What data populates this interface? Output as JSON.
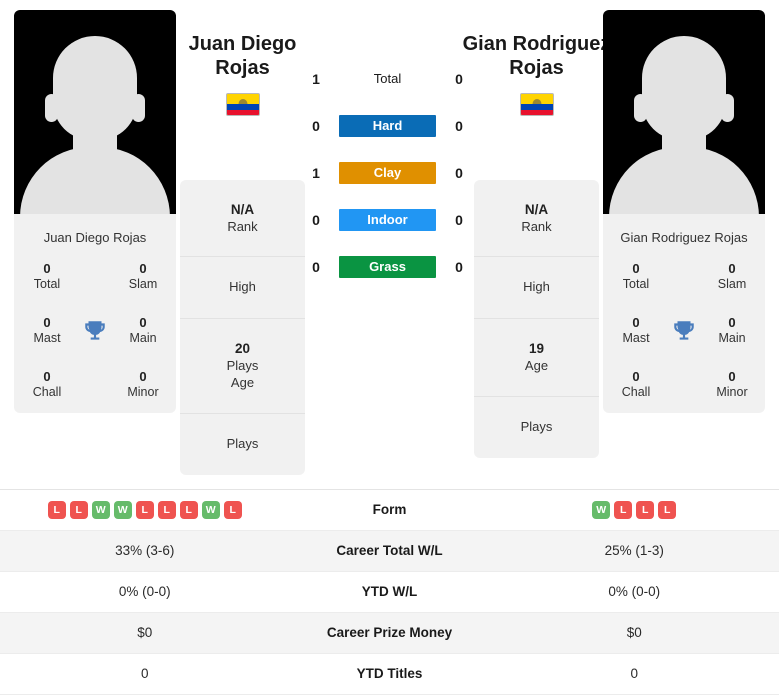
{
  "colors": {
    "hard": "#0a6cb6",
    "clay": "#e09000",
    "indoor": "#2196f3",
    "grass": "#0a9442",
    "win": "#66bb6a",
    "loss": "#ef5350",
    "card_bg": "#f1f1f1",
    "row_shade": "#f4f4f4"
  },
  "left_player": {
    "name_line1": "Juan Diego",
    "name_line2": "Rojas",
    "full_name": "Juan Diego Rojas",
    "country": "Ecuador",
    "avatar": "player-placeholder-silhouette",
    "titles": [
      {
        "value": "0",
        "label": "Total"
      },
      {
        "value": "0",
        "label": "Slam"
      },
      {
        "value": "0",
        "label": "Mast"
      },
      {
        "value": "0",
        "label": "Main"
      },
      {
        "value": "0",
        "label": "Chall"
      },
      {
        "value": "0",
        "label": "Minor"
      }
    ],
    "trophy_icon": "trophy-icon",
    "info": [
      {
        "value": "N/A",
        "label": "Rank"
      },
      {
        "value": "",
        "label": "High"
      },
      {
        "value": "20",
        "label": "Age"
      },
      {
        "value": "",
        "label": "Plays"
      }
    ],
    "form": [
      "L",
      "L",
      "W",
      "W",
      "L",
      "L",
      "L",
      "W",
      "L"
    ]
  },
  "right_player": {
    "name_line1": "Gian Rodriguez",
    "name_line2": "Rojas",
    "full_name": "Gian Rodriguez Rojas",
    "country": "Ecuador",
    "avatar": "player-placeholder-silhouette",
    "titles": [
      {
        "value": "0",
        "label": "Total"
      },
      {
        "value": "0",
        "label": "Slam"
      },
      {
        "value": "0",
        "label": "Mast"
      },
      {
        "value": "0",
        "label": "Main"
      },
      {
        "value": "0",
        "label": "Chall"
      },
      {
        "value": "0",
        "label": "Minor"
      }
    ],
    "trophy_icon": "trophy-icon",
    "info": [
      {
        "value": "N/A",
        "label": "Rank"
      },
      {
        "value": "",
        "label": "High"
      },
      {
        "value": "19",
        "label": "Age"
      },
      {
        "value": "",
        "label": "Plays"
      }
    ],
    "form": [
      "W",
      "L",
      "L",
      "L"
    ]
  },
  "head_to_head": [
    {
      "label": "Total",
      "left": "1",
      "right": "0",
      "style": "plain",
      "color": ""
    },
    {
      "label": "Hard",
      "left": "0",
      "right": "0",
      "style": "badge",
      "color": "#0a6cb6"
    },
    {
      "label": "Clay",
      "left": "1",
      "right": "0",
      "style": "badge",
      "color": "#e09000"
    },
    {
      "label": "Indoor",
      "left": "0",
      "right": "0",
      "style": "badge",
      "color": "#2196f3"
    },
    {
      "label": "Grass",
      "left": "0",
      "right": "0",
      "style": "badge",
      "color": "#0a9442"
    }
  ],
  "stats_rows": [
    {
      "label": "Form",
      "left": "",
      "right": "",
      "type": "form",
      "shaded": false
    },
    {
      "label": "Career Total W/L",
      "left": "33% (3-6)",
      "right": "25% (1-3)",
      "type": "text",
      "shaded": true
    },
    {
      "label": "YTD W/L",
      "left": "0% (0-0)",
      "right": "0% (0-0)",
      "type": "text",
      "shaded": false
    },
    {
      "label": "Career Prize Money",
      "left": "$0",
      "right": "$0",
      "type": "text",
      "shaded": true
    },
    {
      "label": "YTD Titles",
      "left": "0",
      "right": "0",
      "type": "text",
      "shaded": false
    }
  ]
}
